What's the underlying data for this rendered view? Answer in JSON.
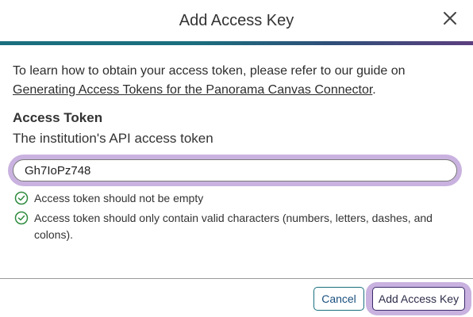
{
  "dialog": {
    "title": "Add Access Key",
    "close_icon": "close-icon"
  },
  "intro": {
    "text_before": "To learn how to obtain your access token, please refer to our guide on",
    "link_text": "Generating Access Tokens for the Panorama Canvas Connector",
    "text_after": "."
  },
  "field": {
    "label": "Access Token",
    "description": "The institution's API access token",
    "value": "Gh7IoPz748"
  },
  "validations": [
    {
      "icon": "check-circle-icon",
      "text": "Access token should not be empty"
    },
    {
      "icon": "check-circle-icon",
      "text": "Access token should only contain valid characters (numbers, letters, dashes, and colons)."
    }
  ],
  "footer": {
    "cancel_label": "Cancel",
    "submit_label": "Add Access Key"
  },
  "colors": {
    "accent_teal": "#1a6f7e",
    "accent_purple": "#5c3f7f",
    "focus_ring": "#c9b2df",
    "success_green": "#2e8b3e"
  }
}
